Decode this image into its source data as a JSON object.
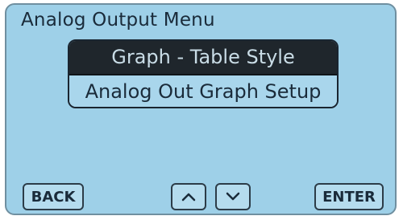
{
  "screen": {
    "title": "Analog Output Menu"
  },
  "menu": {
    "items": [
      {
        "label": "Graph - Table Style",
        "selected": true
      },
      {
        "label": "Analog Out Graph Setup",
        "selected": false
      }
    ]
  },
  "buttons": {
    "back_label": "BACK",
    "up_icon": "chevron-up-icon",
    "down_icon": "chevron-down-icon",
    "enter_label": "ENTER"
  },
  "colors": {
    "screen_background": "#9ed0e8",
    "selected_item_background": "#1f262c",
    "selected_item_text": "#c9dce6",
    "text": "#1a2b3a"
  }
}
